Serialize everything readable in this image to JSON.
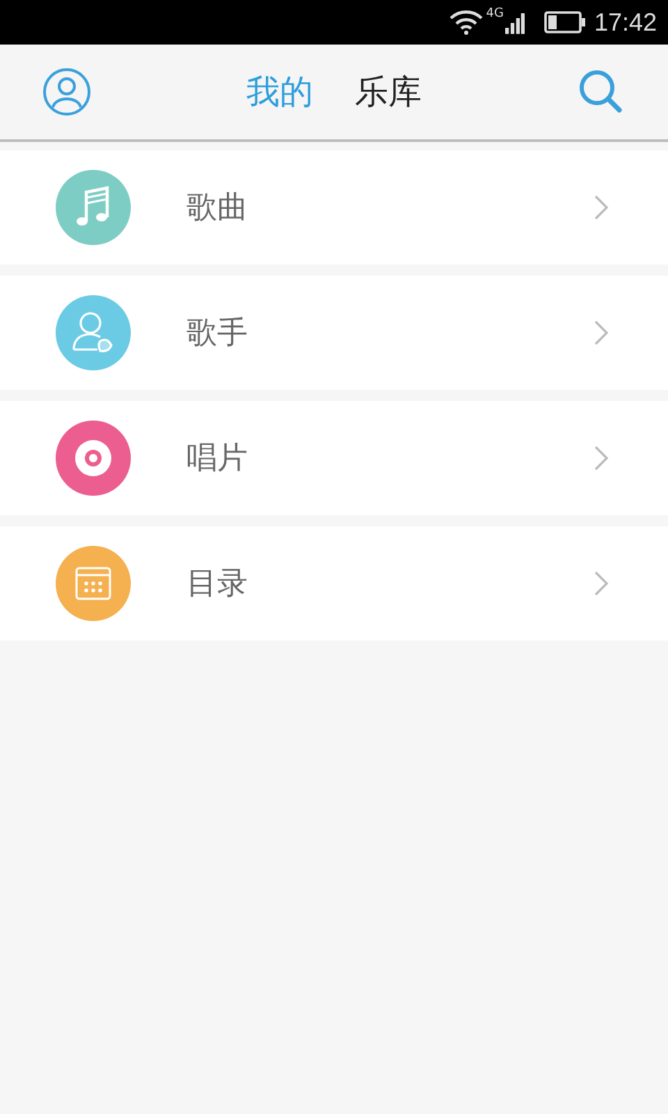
{
  "status_bar": {
    "network": "4G",
    "time": "17:42"
  },
  "tabs": [
    {
      "label": "我的",
      "selected": true
    },
    {
      "label": "乐库",
      "selected": false
    }
  ],
  "items": [
    {
      "kind": "music",
      "label": "歌曲",
      "color": "#7ecdc4"
    },
    {
      "kind": "singer",
      "label": "歌手",
      "color": "#6ccbe4"
    },
    {
      "kind": "disc",
      "label": "唱片",
      "color": "#ec5e8f"
    },
    {
      "kind": "catalog",
      "label": "目录",
      "color": "#f5b04f"
    }
  ]
}
